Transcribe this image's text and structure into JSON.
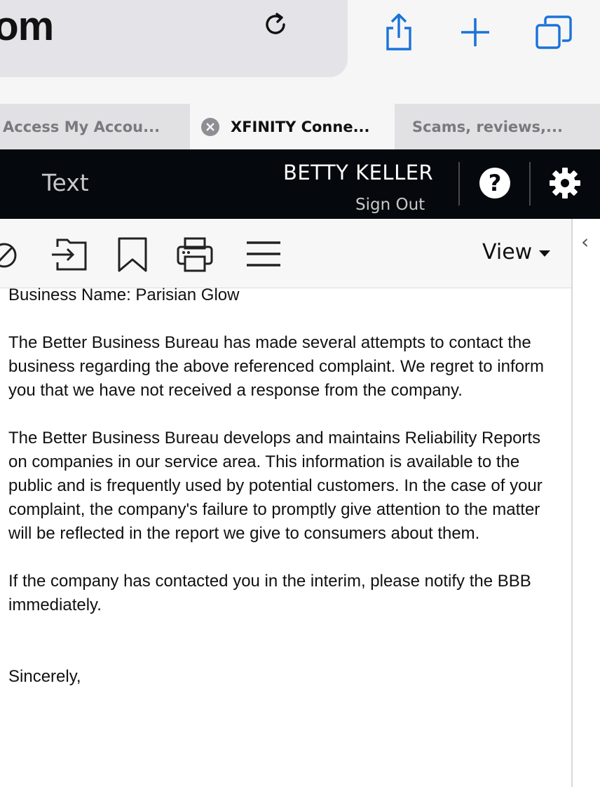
{
  "browser": {
    "url_text": "com",
    "tabs": [
      {
        "label": "Access My Accou..."
      },
      {
        "label": "XFINITY Conne..."
      },
      {
        "label": "Scams, reviews,..."
      }
    ]
  },
  "header": {
    "section_label": "Text",
    "user_name": "BETTY KELLER",
    "sign_out": "Sign Out",
    "help_glyph": "?"
  },
  "toolbar": {
    "view_label": "View"
  },
  "email": {
    "line_business": "Business Name: Parisian Glow",
    "para1": "The Better Business Bureau has made several attempts to contact the business regarding the above referenced complaint. We regret to inform you that we have not received a response from the company.",
    "para2": "The Better Business Bureau develops and maintains Reliability Reports on companies in our service area. This information is available to the public and is frequently used by potential customers. In the case of your complaint, the company's failure to promptly give attention to the matter will be reflected in the report we give to consumers about them.",
    "para3": "If the company has contacted you in the interim, please notify the BBB immediately.",
    "closing": "Sincerely,"
  },
  "colors": {
    "safari_accent": "#1a73d9",
    "header_bg": "#05090d"
  },
  "icons": [
    "reload-icon",
    "share-icon",
    "new-tab-icon",
    "tabs-overview-icon",
    "tab-close-icon",
    "help-icon",
    "gear-icon",
    "no-sign-icon",
    "move-to-folder-icon",
    "bookmark-icon",
    "print-icon",
    "menu-icon",
    "view-caret-icon",
    "chevron-left-icon"
  ]
}
